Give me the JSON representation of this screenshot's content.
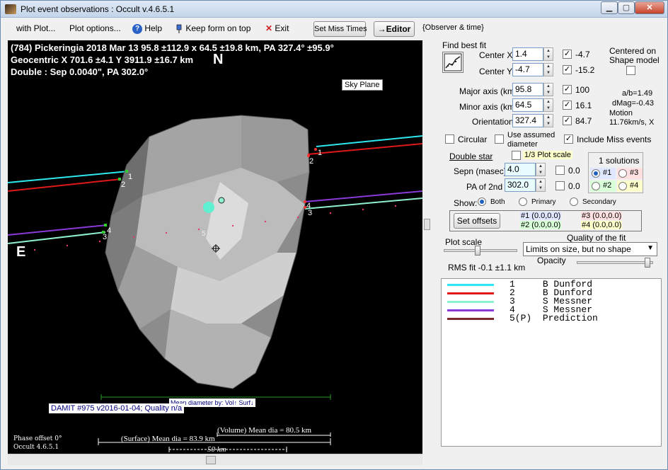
{
  "window": {
    "title": "Plot event observations : Occult v.4.6.5.1",
    "minimize": "▁",
    "maximize": "▢",
    "close": "✕"
  },
  "menu": {
    "with_plot": "with Plot...",
    "plot_options": "Plot options...",
    "help": "Help",
    "keep_on_top": "Keep form on top",
    "exit": "Exit",
    "set_miss_times": "Set Miss Times",
    "editor": "→Editor",
    "observer_time": "{Observer & time}"
  },
  "plot": {
    "line1": "(784) Pickeringia  2018 Mar 13  95.8 ±112.9 x 64.5 ±19.8 km,  PA 327.4° ±95.9°",
    "line2": "Geocentric  X  701.6 ±4.1  Y 3911.9 ±16.7 km",
    "line3": "Double : Sep  0.0040\",  PA 302.0°",
    "north": "N",
    "east": "E",
    "sky_plane": "Sky Plane",
    "damit": "DAMIT #975 v2016-01-04; Quality n/a",
    "mean_dia_by": "Mean diameter by: Vol↑ Surf↓",
    "phase_offset": "Phase offset 0°",
    "version": "Occult 4.6.5.1",
    "volume_dia": "(Volume) Mean dia = 80.5 km",
    "surface_dia": "(Surface) Mean dia = 83.9 km",
    "scale_bar": "50 km",
    "chord_labels_left": [
      "1",
      "2",
      "4",
      "3"
    ],
    "chord_labels_right": [
      "1",
      "2",
      "4",
      "3"
    ],
    "marker5": "5",
    "colors": {
      "cyan": "#2ee8f0",
      "red": "#e01818",
      "teal": "#8ff0d0",
      "purple": "#8a3ad8",
      "pred": "#7a2b2b"
    }
  },
  "panel": {
    "find_best_fit": "Find best fit",
    "center_x_label": "Center X",
    "center_x": "1.4",
    "center_x_fit": "-4.7",
    "center_y_label": "Center Y",
    "center_y": "-4.7",
    "center_y_fit": "-15.2",
    "centered_on": "Centered on",
    "shape_model": "Shape model",
    "major_label": "Major axis (km)",
    "major": "95.8",
    "major_fit": "100",
    "minor_label": "Minor axis (km)",
    "minor": "64.5",
    "minor_fit": "16.1",
    "orient_label": "Orientation",
    "orient": "327.4",
    "orient_fit": "84.7",
    "ab": "a/b=1.49",
    "dmag": "dMag=-0.43",
    "motion": "Motion",
    "motion_val": "11.76km/s, X",
    "circular": "Circular",
    "use_assumed": "Use assumed",
    "diameter": "diameter",
    "include_miss": "Include Miss events",
    "double_star": "Double star",
    "third_scale": "1/3 Plot scale",
    "solutions": "1 solutions",
    "sol1": "#1",
    "sol2": "#2",
    "sol3": "#3",
    "sol4": "#4",
    "sepn_label": "Sepn (masec)",
    "sepn": "4.0",
    "sepn_fit": "0.0",
    "pa2_label": "PA of 2nd",
    "pa2": "302.0",
    "pa2_fit": "0.0",
    "show": "Show:",
    "both": "Both",
    "primary": "Primary",
    "secondary": "Secondary",
    "set_offsets": "Set offsets",
    "off1": "#1 (0.0,0.0)",
    "off2": "#2 (0.0,0.0)",
    "off3": "#3 (0.0,0.0)",
    "off4": "#4 (0.0,0.0)",
    "plot_scale": "Plot scale",
    "quality_label": "Quality of the fit",
    "quality_value": "Limits on size, but no shape",
    "opacity": "Opacity",
    "rms": "RMS fit -0.1 ±1.1 km"
  },
  "legend": [
    {
      "num": "1",
      "name": "B Dunford",
      "color": "#2ee8f0"
    },
    {
      "num": "2",
      "name": "B Dunford",
      "color": "#e01818"
    },
    {
      "num": "3",
      "name": "S Messner",
      "color": "#8ff0d0"
    },
    {
      "num": "4",
      "name": "S Messner",
      "color": "#8a3ad8"
    },
    {
      "num": "5(P)",
      "name": "Prediction",
      "color": "#7a2b2b"
    }
  ]
}
